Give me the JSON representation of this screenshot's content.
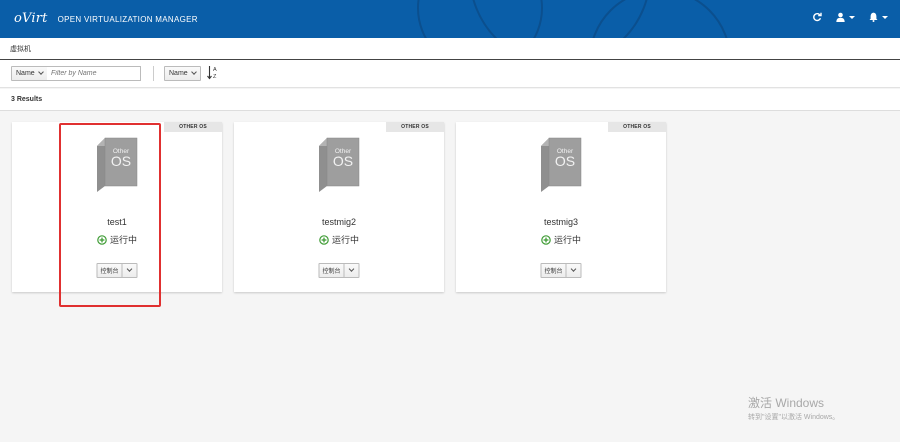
{
  "header": {
    "logo": "oVirt",
    "product": "OPEN VIRTUALIZATION MANAGER",
    "icons": [
      "refresh-icon",
      "user-icon",
      "bell-icon"
    ],
    "bg_color": "#0a5ea8"
  },
  "breadcrumb": "虚拟机",
  "toolbar": {
    "filter_label": "Name",
    "search_placeholder": "Filter by Name",
    "sort_label": "Name"
  },
  "results": {
    "count_label": "3 Results"
  },
  "vms": [
    {
      "name": "test1",
      "status": "运行中",
      "os_label": "OTHER OS",
      "console_label": "控制台"
    },
    {
      "name": "testmig2",
      "status": "运行中",
      "os_label": "OTHER OS",
      "console_label": "控制台"
    },
    {
      "name": "testmig3",
      "status": "运行中",
      "os_label": "OTHER OS",
      "console_label": "控制台"
    }
  ],
  "os_art": {
    "top_text": "Other",
    "main_text": "OS"
  },
  "status_color": "#3f9c35",
  "highlight_color": "#e03030",
  "watermark": {
    "title": "激活 Windows",
    "subtitle": "转到\"设置\"以激活 Windows。"
  }
}
